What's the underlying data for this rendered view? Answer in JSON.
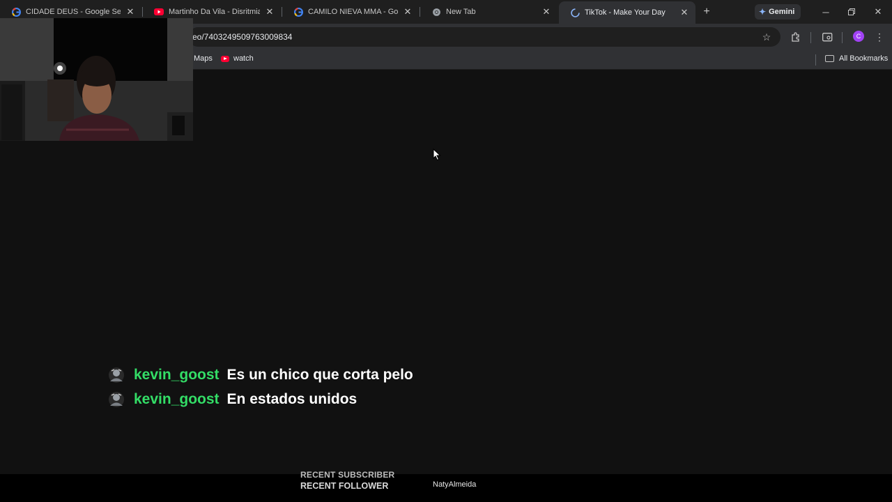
{
  "browser": {
    "tabs": [
      {
        "title": "CIDADE DEUS - Google Search",
        "icon": "google-icon"
      },
      {
        "title": "Martinho Da Vila - Disritmia (Á",
        "icon": "youtube-icon"
      },
      {
        "title": "CAMILO NIEVA MMA - Google",
        "icon": "google-icon"
      },
      {
        "title": "New Tab",
        "icon": "chrome-icon"
      },
      {
        "title": "TikTok - Make Your Day",
        "icon": "loading-icon",
        "active": true
      }
    ],
    "gemini_label": "Gemini",
    "url": "eo/7403249509763009834",
    "profile_initial": "C",
    "bookmarks": [
      {
        "label": "Maps"
      },
      {
        "label": "watch",
        "icon": "youtube-icon"
      }
    ],
    "all_bookmarks_label": "All Bookmarks"
  },
  "chat": {
    "messages": [
      {
        "user": "kevin_goost",
        "text": "Es un chico que corta pelo"
      },
      {
        "user": "kevin_goost",
        "text": "En estados unidos"
      }
    ]
  },
  "overlay": {
    "recent_subscriber_label": "RECENT SUBSCRIBER",
    "recent_follower_label": "RECENT FOLLOWER",
    "recent_follower_name": "NatyAlmeida"
  },
  "colors": {
    "page_bg": "#111111",
    "chat_username": "#33dd66",
    "chat_text": "#ffffff",
    "tab_strip": "#1f1f1f",
    "toolbar": "#303134",
    "profile": "#a142f4"
  }
}
